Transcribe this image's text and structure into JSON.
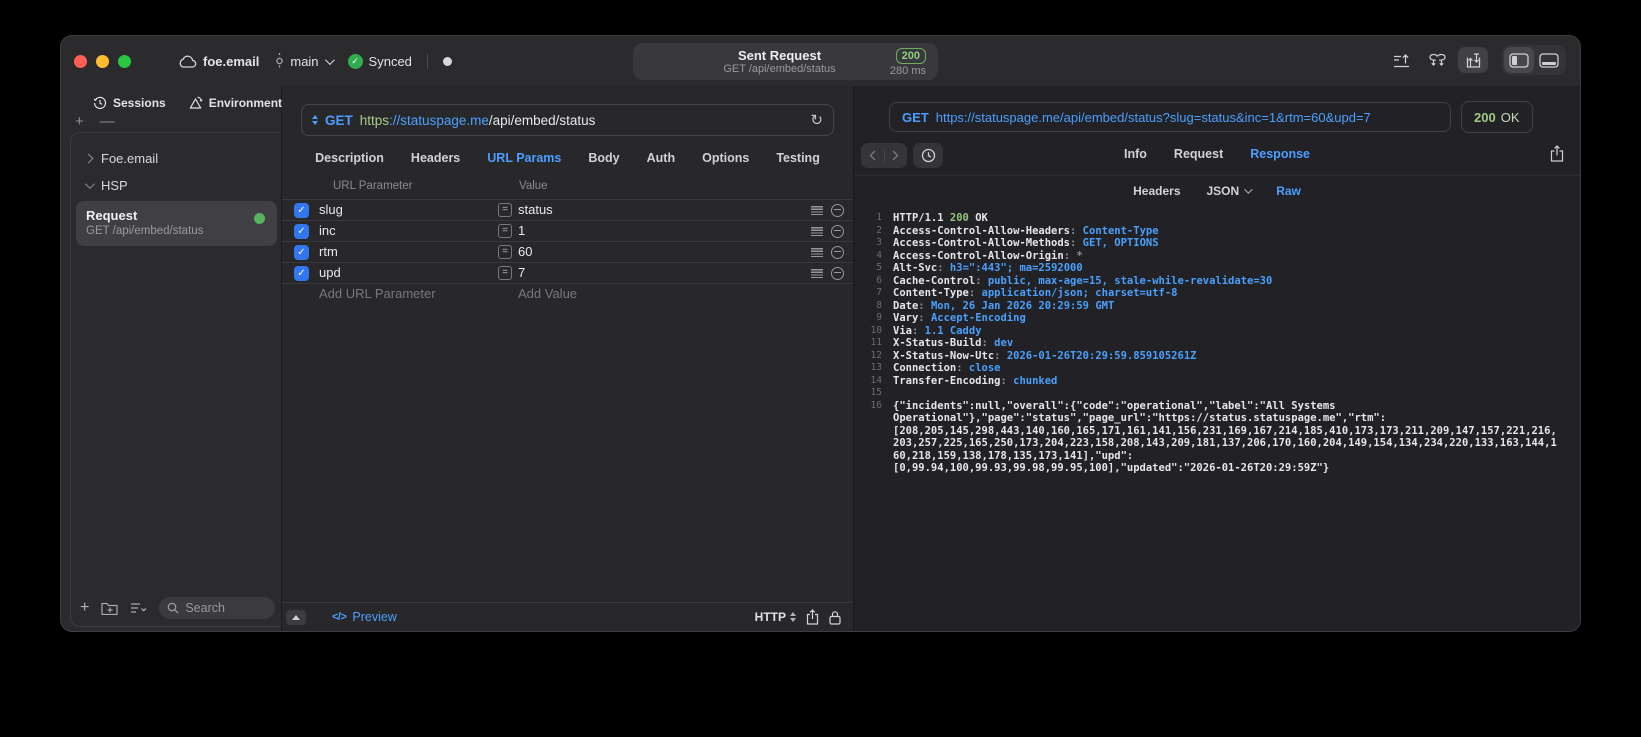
{
  "colors": {
    "accent_blue": "#4b9eff",
    "status_green": "#98c379",
    "checkbox_blue": "#3277f0",
    "badge_green": "#8fd07a"
  },
  "titlebar": {
    "project": "foe.email",
    "branch": "main",
    "sync_status": "Synced",
    "request_title": "Sent Request",
    "request_subtitle": "GET /api/embed/status",
    "status_code": "200",
    "duration": "280 ms"
  },
  "sidebar": {
    "tabs": [
      {
        "label": "Sessions",
        "icon": "history-icon"
      },
      {
        "label": "Environments",
        "icon": "environments-icon"
      }
    ],
    "tree": [
      {
        "label": "Foe.email",
        "expanded": false
      },
      {
        "label": "HSP",
        "expanded": true
      }
    ],
    "request_item": {
      "title": "Request",
      "subtitle": "GET /api/embed/status",
      "status_dot": "green"
    },
    "search_placeholder": "Search"
  },
  "request_panel": {
    "method": "GET",
    "url_scheme": "https",
    "url_host": "://statuspage.me",
    "url_path": "/api/embed/status",
    "tabs": [
      "Description",
      "Headers",
      "URL Params",
      "Body",
      "Auth",
      "Options",
      "Testing"
    ],
    "active_tab": "URL Params",
    "params_table": {
      "columns": [
        "URL Parameter",
        "Value"
      ],
      "rows": [
        {
          "name": "slug",
          "value": "status",
          "checked": true
        },
        {
          "name": "inc",
          "value": "1",
          "checked": true
        },
        {
          "name": "rtm",
          "value": "60",
          "checked": true
        },
        {
          "name": "upd",
          "value": "7",
          "checked": true
        }
      ],
      "add_name_placeholder": "Add URL Parameter",
      "add_value_placeholder": "Add Value"
    },
    "footer": {
      "preview_label": "Preview",
      "preview_glyph": "</>",
      "protocol": "HTTP"
    }
  },
  "response_panel": {
    "method": "GET",
    "url": "https://statuspage.me/api/embed/status?slug=status&inc=1&rtm=60&upd=7",
    "status_code": "200",
    "status_text": "OK",
    "tabs": [
      "Info",
      "Request",
      "Response"
    ],
    "active_tab": "Response",
    "subtabs": [
      {
        "label": "Headers",
        "chevron": false
      },
      {
        "label": "JSON",
        "chevron": true
      },
      {
        "label": "Raw",
        "chevron": false
      }
    ],
    "active_subtab": "Raw",
    "code_lines": [
      {
        "n": 1,
        "parts": [
          [
            "w",
            "HTTP/1.1 "
          ],
          [
            "g",
            "200"
          ],
          [
            "w",
            " OK"
          ]
        ]
      },
      {
        "n": 2,
        "parts": [
          [
            "w",
            "Access-Control-Allow-Headers"
          ],
          [
            "d",
            ": "
          ],
          [
            "b",
            "Content-Type"
          ]
        ]
      },
      {
        "n": 3,
        "parts": [
          [
            "w",
            "Access-Control-Allow-Methods"
          ],
          [
            "d",
            ": "
          ],
          [
            "b",
            "GET, OPTIONS"
          ]
        ]
      },
      {
        "n": 4,
        "parts": [
          [
            "w",
            "Access-Control-Allow-Origin"
          ],
          [
            "d",
            ": "
          ],
          [
            "d",
            "*"
          ]
        ]
      },
      {
        "n": 5,
        "parts": [
          [
            "w",
            "Alt-Svc"
          ],
          [
            "d",
            ": "
          ],
          [
            "b",
            "h3=\":443\"; ma=2592000"
          ]
        ]
      },
      {
        "n": 6,
        "parts": [
          [
            "w",
            "Cache-Control"
          ],
          [
            "d",
            ": "
          ],
          [
            "b",
            "public, max-age=15, stale-while-revalidate=30"
          ]
        ]
      },
      {
        "n": 7,
        "parts": [
          [
            "w",
            "Content-Type"
          ],
          [
            "d",
            ": "
          ],
          [
            "b",
            "application/json; charset=utf-8"
          ]
        ]
      },
      {
        "n": 8,
        "parts": [
          [
            "w",
            "Date"
          ],
          [
            "d",
            ": "
          ],
          [
            "b",
            "Mon, 26 Jan 2026 20:29:59 GMT"
          ]
        ]
      },
      {
        "n": 9,
        "parts": [
          [
            "w",
            "Vary"
          ],
          [
            "d",
            ": "
          ],
          [
            "b",
            "Accept-Encoding"
          ]
        ]
      },
      {
        "n": 10,
        "parts": [
          [
            "w",
            "Via"
          ],
          [
            "d",
            ": "
          ],
          [
            "b",
            "1.1 Caddy"
          ]
        ]
      },
      {
        "n": 11,
        "parts": [
          [
            "w",
            "X-Status-Build"
          ],
          [
            "d",
            ": "
          ],
          [
            "b",
            "dev"
          ]
        ]
      },
      {
        "n": 12,
        "parts": [
          [
            "w",
            "X-Status-Now-Utc"
          ],
          [
            "d",
            ": "
          ],
          [
            "b",
            "2026-01-26T20:29:59.859105261Z"
          ]
        ]
      },
      {
        "n": 13,
        "parts": [
          [
            "w",
            "Connection"
          ],
          [
            "d",
            ": "
          ],
          [
            "b",
            "close"
          ]
        ]
      },
      {
        "n": 14,
        "parts": [
          [
            "w",
            "Transfer-Encoding"
          ],
          [
            "d",
            ": "
          ],
          [
            "b",
            "chunked"
          ]
        ]
      },
      {
        "n": 15,
        "parts": []
      },
      {
        "n": 16,
        "lines": [
          "{\"incidents\":null,\"overall\":{\"code\":\"operational\",\"label\":\"All Systems",
          "Operational\"},\"page\":\"status\",\"page_url\":\"https://status.statuspage.me\",\"rtm\":",
          "[208,205,145,298,443,140,160,165,171,161,141,156,231,169,167,214,185,410,173,173,211,209,147,157,221,216,",
          "203,257,225,165,250,173,204,223,158,208,143,209,181,137,206,170,160,204,149,154,134,234,220,133,163,144,1",
          "60,218,159,138,178,135,173,141],\"upd\":",
          "[0,99.94,100,99.93,99.98,99.95,100],\"updated\":\"2026-01-26T20:29:59Z\"}"
        ]
      }
    ]
  }
}
